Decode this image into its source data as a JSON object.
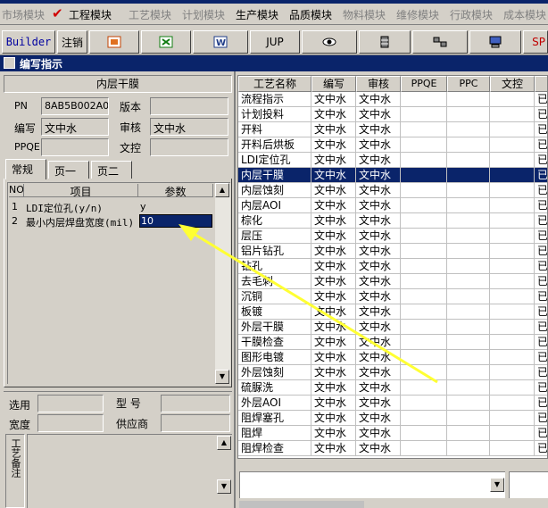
{
  "menu": {
    "items": [
      {
        "label": "市场模块",
        "active": false
      },
      {
        "label": "工程模块",
        "active": true
      },
      {
        "label": "工艺模块",
        "active": false
      },
      {
        "label": "计划模块",
        "active": false
      },
      {
        "label": "生产模块",
        "active": true
      },
      {
        "label": "品质模块",
        "active": true
      },
      {
        "label": "物料模块",
        "active": false
      },
      {
        "label": "维修模块",
        "active": false
      },
      {
        "label": "行政模块",
        "active": false
      },
      {
        "label": "成本模块",
        "active": false
      }
    ]
  },
  "toolbar": {
    "builder": "Builder",
    "logout": "注销",
    "jump": "JUP",
    "sp": "SP"
  },
  "window": {
    "title": "编写指示"
  },
  "form": {
    "section_title": "内层干膜",
    "pn_label": "PN",
    "pn_value": "8AB5B002A0",
    "version_label": "版本",
    "version_value": "",
    "author_label": "编写",
    "author_value": "文中水",
    "reviewer_label": "审核",
    "reviewer_value": "文中水",
    "ppqe_label": "PPQE",
    "ppqe_value": "",
    "doc_control_label": "文控",
    "doc_control_value": ""
  },
  "tabs": [
    "常规",
    "页一",
    "页二"
  ],
  "param_grid": {
    "headers": [
      "NO",
      "项目",
      "参数"
    ],
    "rows": [
      {
        "no": "1",
        "item": "LDI定位孔(y/n)",
        "value": "y"
      },
      {
        "no": "2",
        "item": "最小内层焊盘宽度(mil)",
        "value": "10"
      }
    ]
  },
  "bottom_form": {
    "select_label": "选用",
    "model_label": "型  号",
    "width_label": "宽度",
    "supplier_label": "供应商",
    "notes_label": "工艺备注"
  },
  "process_grid": {
    "headers": [
      "工艺名称",
      "编写",
      "审核",
      "PPQE",
      "PPC",
      "文控",
      ""
    ],
    "rows": [
      {
        "name": "流程指示",
        "author": "文中水",
        "reviewer": "文中水",
        "status": "已"
      },
      {
        "name": "计划投料",
        "author": "文中水",
        "reviewer": "文中水",
        "status": "已"
      },
      {
        "name": "开料",
        "author": "文中水",
        "reviewer": "文中水",
        "status": "已"
      },
      {
        "name": "开料后烘板",
        "author": "文中水",
        "reviewer": "文中水",
        "status": "已"
      },
      {
        "name": "LDI定位孔",
        "author": "文中水",
        "reviewer": "文中水",
        "status": "已"
      },
      {
        "name": "内层干膜",
        "author": "文中水",
        "reviewer": "文中水",
        "status": "已",
        "selected": true
      },
      {
        "name": "内层蚀刻",
        "author": "文中水",
        "reviewer": "文中水",
        "status": "已"
      },
      {
        "name": "内层AOI",
        "author": "文中水",
        "reviewer": "文中水",
        "status": "已"
      },
      {
        "name": "棕化",
        "author": "文中水",
        "reviewer": "文中水",
        "status": "已"
      },
      {
        "name": "层压",
        "author": "文中水",
        "reviewer": "文中水",
        "status": "已"
      },
      {
        "name": "铝片钻孔",
        "author": "文中水",
        "reviewer": "文中水",
        "status": "已"
      },
      {
        "name": "钻孔",
        "author": "文中水",
        "reviewer": "文中水",
        "status": "已"
      },
      {
        "name": "去毛刺",
        "author": "文中水",
        "reviewer": "文中水",
        "status": "已"
      },
      {
        "name": "沉铜",
        "author": "文中水",
        "reviewer": "文中水",
        "status": "已"
      },
      {
        "name": "板镀",
        "author": "文中水",
        "reviewer": "文中水",
        "status": "已"
      },
      {
        "name": "外层干膜",
        "author": "文中水",
        "reviewer": "文中水",
        "status": "已"
      },
      {
        "name": "干膜检查",
        "author": "文中水",
        "reviewer": "文中水",
        "status": "已"
      },
      {
        "name": "图形电镀",
        "author": "文中水",
        "reviewer": "文中水",
        "status": "已"
      },
      {
        "name": "外层蚀刻",
        "author": "文中水",
        "reviewer": "文中水",
        "status": "已"
      },
      {
        "name": "硫脲洗",
        "author": "文中水",
        "reviewer": "文中水",
        "status": "已"
      },
      {
        "name": "外层AOI",
        "author": "文中水",
        "reviewer": "文中水",
        "status": "已"
      },
      {
        "name": "阻焊塞孔",
        "author": "文中水",
        "reviewer": "文中水",
        "status": "已"
      },
      {
        "name": "阻焊",
        "author": "文中水",
        "reviewer": "文中水",
        "status": "已"
      },
      {
        "name": "阻焊检查",
        "author": "文中水",
        "reviewer": "文中水",
        "status": "已"
      }
    ]
  },
  "colors": {
    "title_bar": "#0a246a",
    "selection": "#0a246a",
    "annotation_arrow": "#ffff33"
  }
}
